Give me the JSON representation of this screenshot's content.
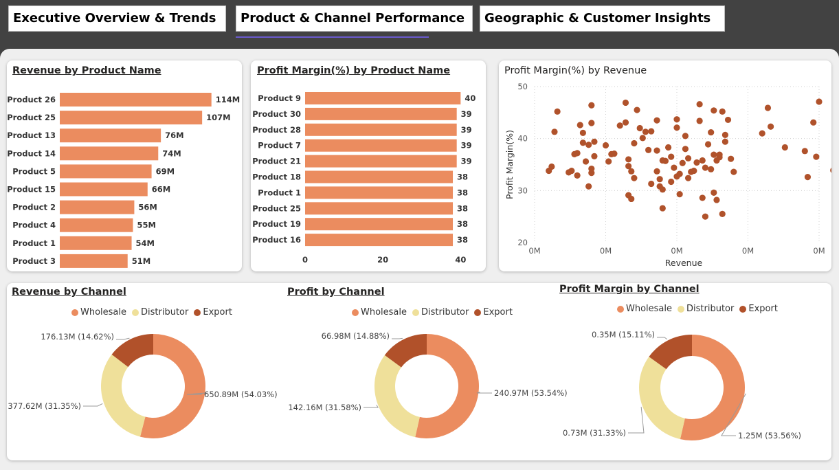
{
  "tabs": [
    {
      "label": "Executive Overview & Trends"
    },
    {
      "label": "Product & Channel Performance"
    },
    {
      "label": "Geographic & Customer Insights"
    }
  ],
  "colors": {
    "wholesale": "#eb8c5f",
    "distributor": "#efe09a",
    "export": "#b1512a",
    "bar": "#eb8c5f",
    "scatter": "#b0522b"
  },
  "revenue_by_product": {
    "title": "Revenue by Product Name",
    "chart_data": {
      "type": "bar",
      "orientation": "horizontal",
      "categories": [
        "Product 26",
        "Product 25",
        "Product 13",
        "Product 14",
        "Product 5",
        "Product 15",
        "Product 2",
        "Product 4",
        "Product 1",
        "Product 3"
      ],
      "values": [
        114,
        107,
        76,
        74,
        69,
        66,
        56,
        55,
        54,
        51
      ],
      "data_labels": [
        "114M",
        "107M",
        "76M",
        "74M",
        "69M",
        "66M",
        "56M",
        "55M",
        "54M",
        "51M"
      ],
      "unit": "M",
      "xlim": [
        0,
        125
      ]
    }
  },
  "profit_margin_by_product": {
    "title": "Profit Margin(%) by Product Name",
    "chart_data": {
      "type": "bar",
      "orientation": "horizontal",
      "categories": [
        "Product 9",
        "Product 30",
        "Product 28",
        "Product 7",
        "Product 21",
        "Product 18",
        "Product 1",
        "Product 25",
        "Product 19",
        "Product 16"
      ],
      "values": [
        40,
        39,
        39,
        39,
        39,
        38,
        38,
        38,
        38,
        38
      ],
      "data_labels": [
        "40",
        "39",
        "39",
        "39",
        "39",
        "38",
        "38",
        "38",
        "38",
        "38"
      ],
      "xticks": [
        "0",
        "20",
        "40"
      ],
      "xlim": [
        0,
        41
      ]
    }
  },
  "scatter_margin_revenue": {
    "title": "Profit Margin(%) by Revenue",
    "chart_data": {
      "type": "scatter",
      "xlabel": "Revenue",
      "ylabel": "Profit Margin(%)",
      "xticks": [
        "0M",
        "0M",
        "0M",
        "0M",
        "0M"
      ],
      "yticks": [
        "20",
        "30",
        "40",
        "50"
      ],
      "ylim": [
        20,
        50
      ],
      "xlim": [
        0,
        100
      ],
      "grid": true,
      "points": [
        [
          5,
          33.8
        ],
        [
          6,
          34.6
        ],
        [
          7,
          41.3
        ],
        [
          8,
          45.2
        ],
        [
          12,
          33.5
        ],
        [
          13,
          33.8
        ],
        [
          14,
          37
        ],
        [
          15,
          37.2
        ],
        [
          15,
          32.9
        ],
        [
          16,
          42.6
        ],
        [
          17,
          39.2
        ],
        [
          17,
          41.1
        ],
        [
          18,
          35.6
        ],
        [
          19,
          38.8
        ],
        [
          19,
          30.8
        ],
        [
          20,
          33.4
        ],
        [
          20,
          34.2
        ],
        [
          20,
          43
        ],
        [
          20,
          46.4
        ],
        [
          21,
          36.6
        ],
        [
          21,
          39.4
        ],
        [
          25,
          38.7
        ],
        [
          26,
          35.6
        ],
        [
          27,
          37
        ],
        [
          28,
          37.1
        ],
        [
          30,
          42.5
        ],
        [
          32,
          46.9
        ],
        [
          32,
          43.1
        ],
        [
          33,
          36
        ],
        [
          33,
          34.7
        ],
        [
          33,
          29.1
        ],
        [
          34,
          28.4
        ],
        [
          34,
          33.7
        ],
        [
          35,
          32.4
        ],
        [
          35,
          39.1
        ],
        [
          36,
          45.5
        ],
        [
          37,
          42
        ],
        [
          38,
          40.1
        ],
        [
          39,
          41.3
        ],
        [
          40,
          37.8
        ],
        [
          41,
          41.4
        ],
        [
          41,
          31.3
        ],
        [
          43,
          43.5
        ],
        [
          43,
          37.7
        ],
        [
          43,
          33.7
        ],
        [
          44,
          32.2
        ],
        [
          44,
          30.8
        ],
        [
          45,
          35.8
        ],
        [
          45,
          26.6
        ],
        [
          45,
          30.2
        ],
        [
          46,
          35.7
        ],
        [
          47,
          38.3
        ],
        [
          48,
          36.5
        ],
        [
          48,
          31.7
        ],
        [
          49,
          34.4
        ],
        [
          50,
          42.1
        ],
        [
          50,
          43.7
        ],
        [
          50,
          32.7
        ],
        [
          51,
          33.2
        ],
        [
          51,
          29.3
        ],
        [
          52,
          35.3
        ],
        [
          53,
          40.5
        ],
        [
          53,
          38
        ],
        [
          54,
          36.2
        ],
        [
          54,
          32.4
        ],
        [
          55,
          33.6
        ],
        [
          56,
          33.8
        ],
        [
          57,
          35.4
        ],
        [
          58,
          43.4
        ],
        [
          58,
          46.6
        ],
        [
          59,
          35.8
        ],
        [
          59,
          28.6
        ],
        [
          60,
          34.4
        ],
        [
          60,
          25
        ],
        [
          61,
          38.9
        ],
        [
          62,
          41.2
        ],
        [
          62,
          34.1
        ],
        [
          63,
          45.4
        ],
        [
          63,
          36.9
        ],
        [
          63,
          29.6
        ],
        [
          64,
          28.2
        ],
        [
          64,
          35.8
        ],
        [
          65,
          36.4
        ],
        [
          65,
          36.9
        ],
        [
          66,
          45.2
        ],
        [
          66,
          25.5
        ],
        [
          67,
          40.7
        ],
        [
          67,
          39.4
        ],
        [
          68,
          43.6
        ],
        [
          69,
          36.1
        ],
        [
          70,
          33.6
        ],
        [
          80,
          41
        ],
        [
          82,
          45.9
        ],
        [
          83,
          42.3
        ],
        [
          88,
          38.3
        ],
        [
          95,
          37.6
        ],
        [
          96,
          32.6
        ],
        [
          98,
          43.1
        ],
        [
          99,
          36.5
        ],
        [
          100,
          47.1
        ],
        [
          105,
          33.9
        ],
        [
          118,
          42
        ]
      ]
    }
  },
  "revenue_by_channel": {
    "title": "Revenue by Channel",
    "legend": [
      "Wholesale",
      "Distributor",
      "Export"
    ],
    "chart_data": {
      "type": "pie",
      "donut": true,
      "categories": [
        "Wholesale",
        "Distributor",
        "Export"
      ],
      "values": [
        650.89,
        377.62,
        176.13
      ],
      "percents": [
        54.03,
        31.35,
        14.62
      ],
      "labels": [
        "650.89M (54.03%)",
        "377.62M (31.35%)",
        "176.13M (14.62%)"
      ]
    }
  },
  "profit_by_channel": {
    "title": "Profit by Channel",
    "legend": [
      "Wholesale",
      "Distributor",
      "Export"
    ],
    "chart_data": {
      "type": "pie",
      "donut": true,
      "categories": [
        "Wholesale",
        "Distributor",
        "Export"
      ],
      "values": [
        240.97,
        142.16,
        66.98
      ],
      "percents": [
        53.54,
        31.58,
        14.88
      ],
      "labels": [
        "240.97M (53.54%)",
        "142.16M (31.58%)",
        "66.98M (14.88%)"
      ]
    }
  },
  "profit_margin_by_channel": {
    "title": "Profit Margin by Channel",
    "legend": [
      "Wholesale",
      "Distributor",
      "Export"
    ],
    "chart_data": {
      "type": "pie",
      "donut": true,
      "categories": [
        "Wholesale",
        "Distributor",
        "Export"
      ],
      "values": [
        1.25,
        0.73,
        0.35
      ],
      "percents": [
        53.56,
        31.33,
        15.11
      ],
      "labels": [
        "1.25M (53.56%)",
        "0.73M (31.33%)",
        "0.35M (15.11%)"
      ]
    }
  }
}
